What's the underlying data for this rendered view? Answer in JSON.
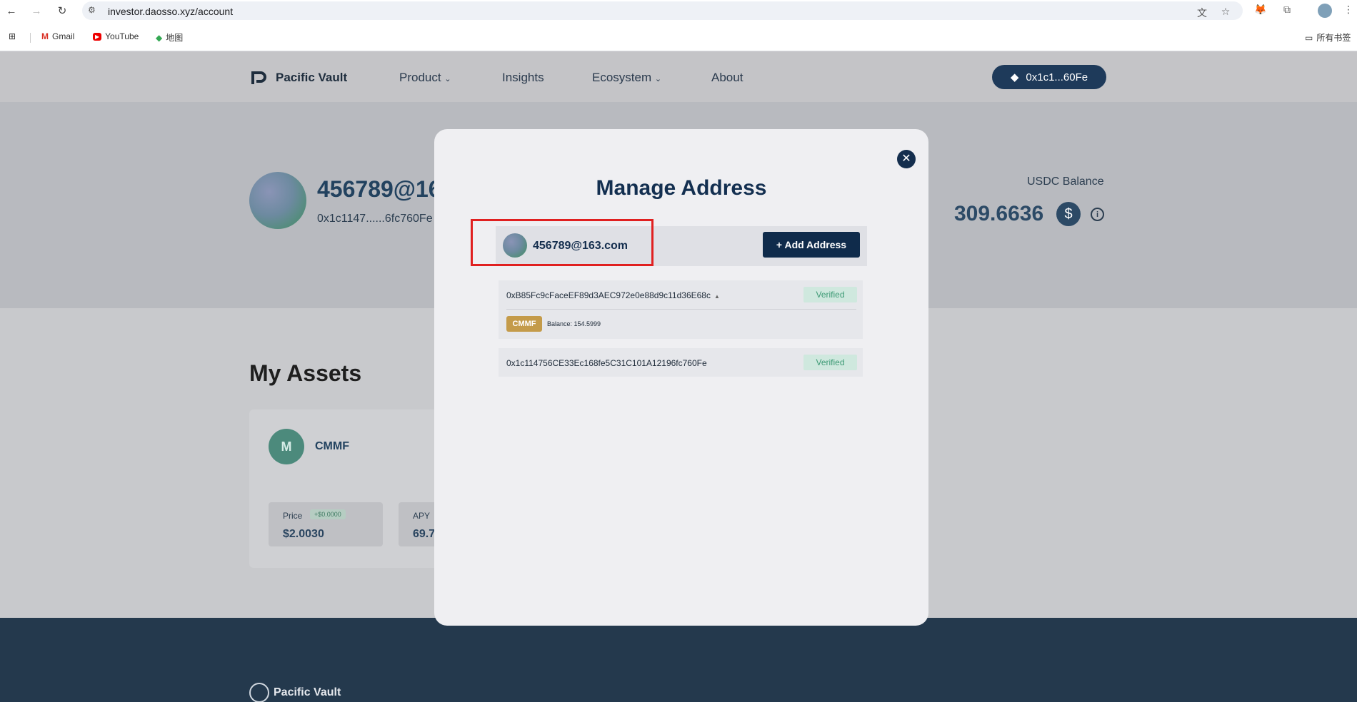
{
  "browser": {
    "url": "investor.daosso.xyz/account",
    "bookmarks": [
      "Gmail",
      "YouTube",
      "地图"
    ],
    "all_bookmarks": "所有书签"
  },
  "site": {
    "brand": "Pacific Vault",
    "nav": [
      "Product",
      "Insights",
      "Ecosystem",
      "About"
    ],
    "wallet": "0x1c1...60Fe"
  },
  "profile": {
    "name": "456789@16",
    "address": "0x1c1147......6fc760Fe",
    "usdc_label": "USDC Balance",
    "usdc_value": "309.6636"
  },
  "assets": {
    "title": "My Assets",
    "card": {
      "logo_text": "M",
      "name": "CMMF",
      "price_label": "Price",
      "price_change": "+$0.0000",
      "price_value": "$2.0030",
      "apy_label": "APY",
      "apy_value": "69.7"
    }
  },
  "modal": {
    "title": "Manage Address",
    "account": "456789@163.com",
    "add_button": "+ Add Address",
    "addresses": [
      {
        "address": "0xB85Fc9cFaceEF89d3AEC972e0e88d9c11d36E68c",
        "status": "Verified",
        "token": "CMMF",
        "balance": "Balance: 154.5999"
      },
      {
        "address": "0x1c114756CE33Ec168fe5C31C101A12196fc760Fe",
        "status": "Verified"
      }
    ]
  },
  "footer": {
    "brand": "Pacific Vault"
  }
}
